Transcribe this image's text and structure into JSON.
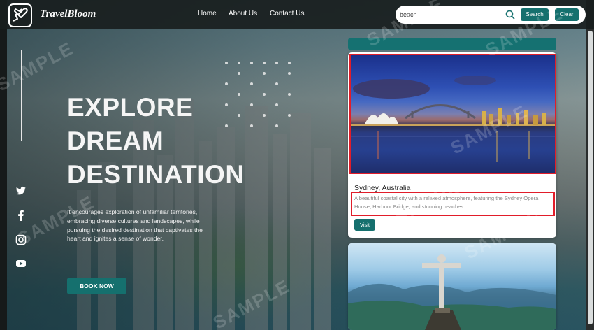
{
  "app": {
    "brand": "TravelBloom"
  },
  "nav": {
    "links": [
      "Home",
      "About Us",
      "Contact Us"
    ]
  },
  "search": {
    "value": "beach",
    "search_label": "Search",
    "clear_label": "Clear"
  },
  "hero": {
    "title_lines": [
      "EXPLORE",
      "DREAM",
      "DESTINATION"
    ],
    "description": "It encourages exploration of unfamiliar territories, embracing diverse cultures and landscapes, while pursuing the desired destination that captivates the heart and ignites a sense of wonder.",
    "cta_label": "BOOK NOW"
  },
  "socials": [
    "twitter-icon",
    "facebook-icon",
    "instagram-icon",
    "youtube-icon"
  ],
  "results": [
    {
      "name": "Sydney, Australia",
      "description": "A beautiful coastal city with a relaxed atmosphere, featuring the Sydney Opera House, Harbour Bridge, and stunning beaches.",
      "action_label": "Visit"
    }
  ],
  "watermark": "SAMPLE",
  "colors": {
    "accent": "#15706e",
    "highlight": "#e11d2a"
  }
}
